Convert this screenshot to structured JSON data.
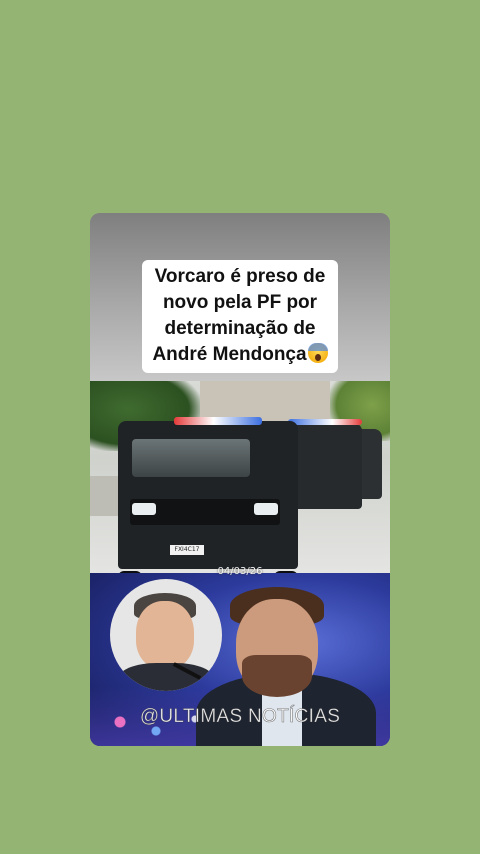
{
  "headline": {
    "line1": "Vorcaro é preso de",
    "line2": "novo pela PF por",
    "line3": "determinação de",
    "line4": "André Mendonça",
    "emoji": "face-screaming-in-fear"
  },
  "scene": {
    "vehicle_plate": "FXI4C17",
    "date": "04/03/26"
  },
  "watermark": "@ULTIMAS NOTÍCIAS",
  "colors": {
    "page_background": "#93b473",
    "headline_box": "#ffffff",
    "headline_text": "#111111"
  }
}
